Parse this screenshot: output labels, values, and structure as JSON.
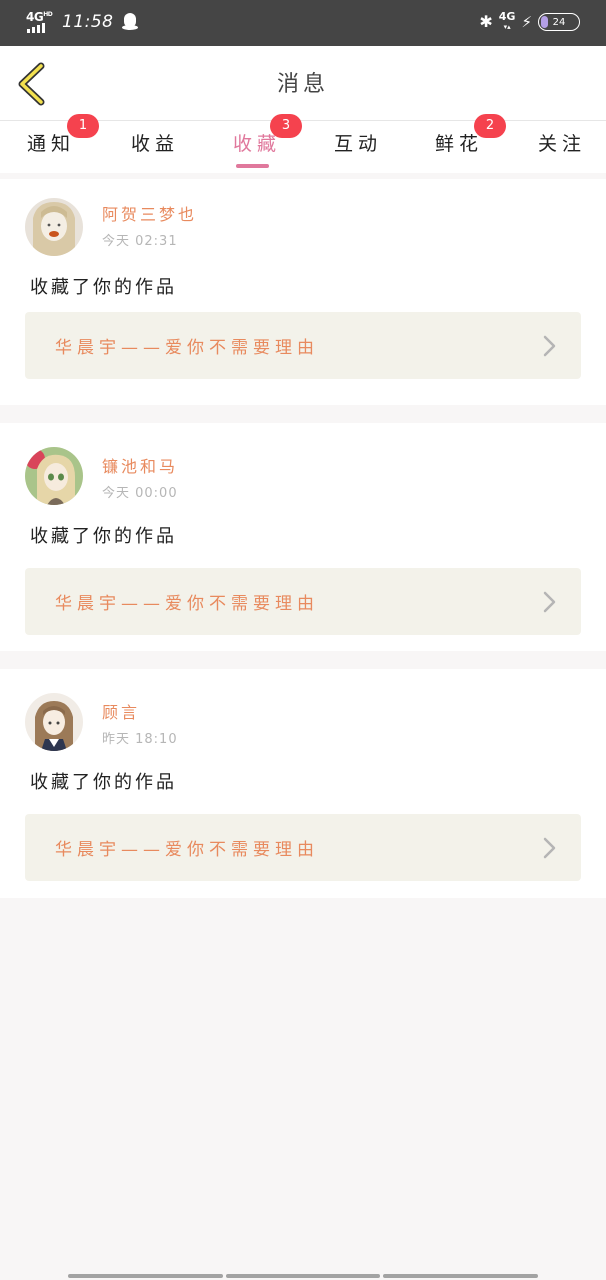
{
  "status_bar": {
    "network": "4G",
    "network_sup": "HD",
    "time": "11:58",
    "bluetooth": "✱",
    "net_right": "4G",
    "battery": "24"
  },
  "header": {
    "title": "消息"
  },
  "tabs": [
    {
      "label": "通知",
      "badge": "1"
    },
    {
      "label": "收益",
      "badge": ""
    },
    {
      "label": "收藏",
      "badge": "3",
      "active": true
    },
    {
      "label": "互动",
      "badge": ""
    },
    {
      "label": "鲜花",
      "badge": "2"
    },
    {
      "label": "关注",
      "badge": ""
    }
  ],
  "items": [
    {
      "username": "阿贺三梦也",
      "time": "今天 02:31",
      "action": "收藏了你的作品",
      "work": "华晨宇——爱你不需要理由"
    },
    {
      "username": "镰池和马",
      "time": "今天 00:00",
      "action": "收藏了你的作品",
      "work": "华晨宇——爱你不需要理由"
    },
    {
      "username": "顾言",
      "time": "昨天 18:10",
      "action": "收藏了你的作品",
      "work": "华晨宇——爱你不需要理由"
    }
  ],
  "colors": {
    "accent": "#e0789c",
    "badge": "#f5424e",
    "username": "#e88a5e",
    "card_link_bg": "#f3f2ea"
  }
}
